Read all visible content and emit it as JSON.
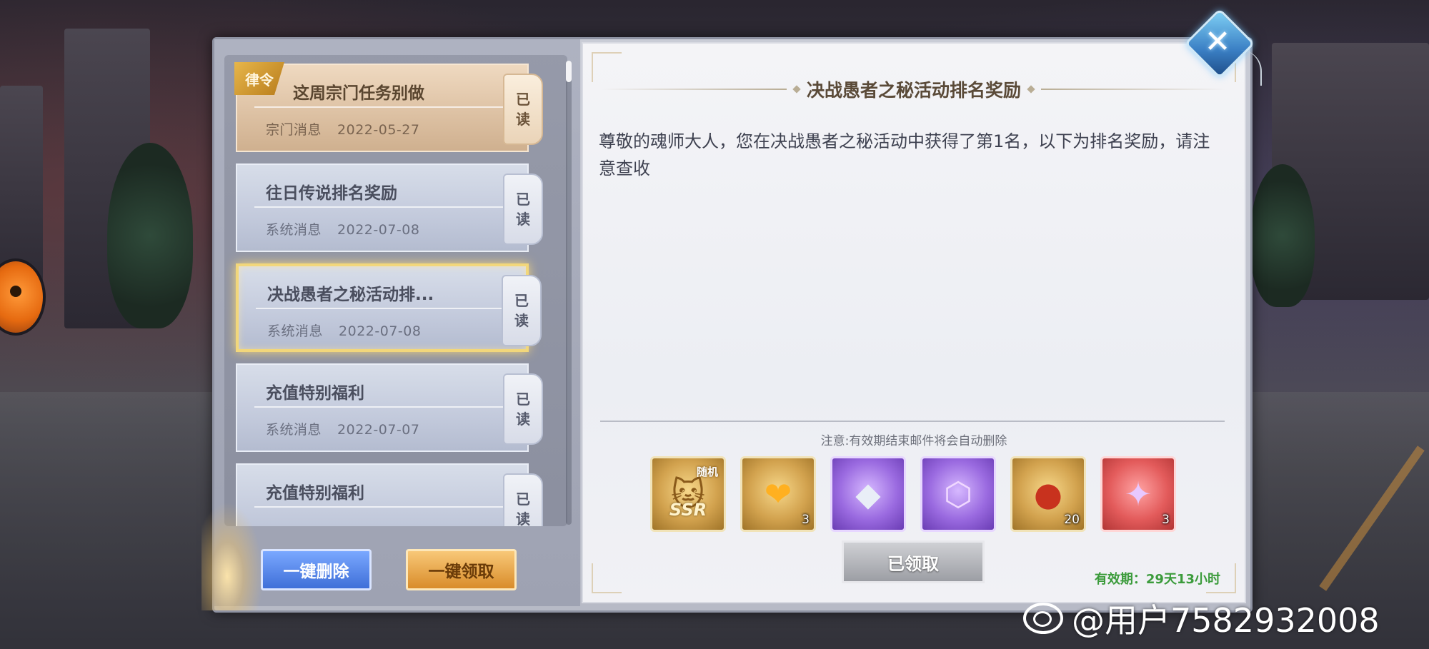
{
  "mails": [
    {
      "title": "这周宗门任务别做",
      "category": "宗门消息",
      "date": "2022-05-27",
      "read_tag": [
        "已",
        "读"
      ],
      "badge": "律令",
      "style": "guild"
    },
    {
      "title": "往日传说排名奖励",
      "category": "系统消息",
      "date": "2022-07-08",
      "read_tag": [
        "已",
        "读"
      ],
      "style": "system"
    },
    {
      "title": "决战愚者之秘活动排...",
      "category": "系统消息",
      "date": "2022-07-08",
      "read_tag": [
        "已",
        "读"
      ],
      "style": "system",
      "selected": true
    },
    {
      "title": "充值特别福利",
      "category": "系统消息",
      "date": "2022-07-07",
      "read_tag": [
        "已",
        "读"
      ],
      "style": "system"
    },
    {
      "title": "充值特别福利",
      "category": "",
      "date": "",
      "read_tag": [
        "已",
        "读"
      ],
      "style": "system"
    }
  ],
  "buttons": {
    "delete_all": "一键删除",
    "claim_all": "一键领取",
    "claimed": "已领取"
  },
  "letter": {
    "title": "决战愚者之秘活动排名奖励",
    "body": "尊敬的魂师大人，您在决战愚者之秘活动中获得了第1名，以下为排名奖励，请注意查收",
    "note": "注意:有效期结束邮件将会自动删除",
    "validity": "有效期：29天13小时"
  },
  "attachments": [
    {
      "icon": "ssr-random-cat-icon",
      "label_top": "随机",
      "label_bottom": "SSR",
      "quantity": "",
      "color": "gold"
    },
    {
      "icon": "golden-heart-icon",
      "quantity": "3",
      "color": "gold"
    },
    {
      "icon": "crystal-ore-icon",
      "quantity": "",
      "color": "purple"
    },
    {
      "icon": "purple-hexagon-frame-icon",
      "quantity": "",
      "color": "purple"
    },
    {
      "icon": "red-pouch-icon",
      "quantity": "20",
      "color": "gold"
    },
    {
      "icon": "purple-feather-icon",
      "quantity": "3",
      "color": "red"
    }
  ],
  "watermark": "@用户7582932008"
}
